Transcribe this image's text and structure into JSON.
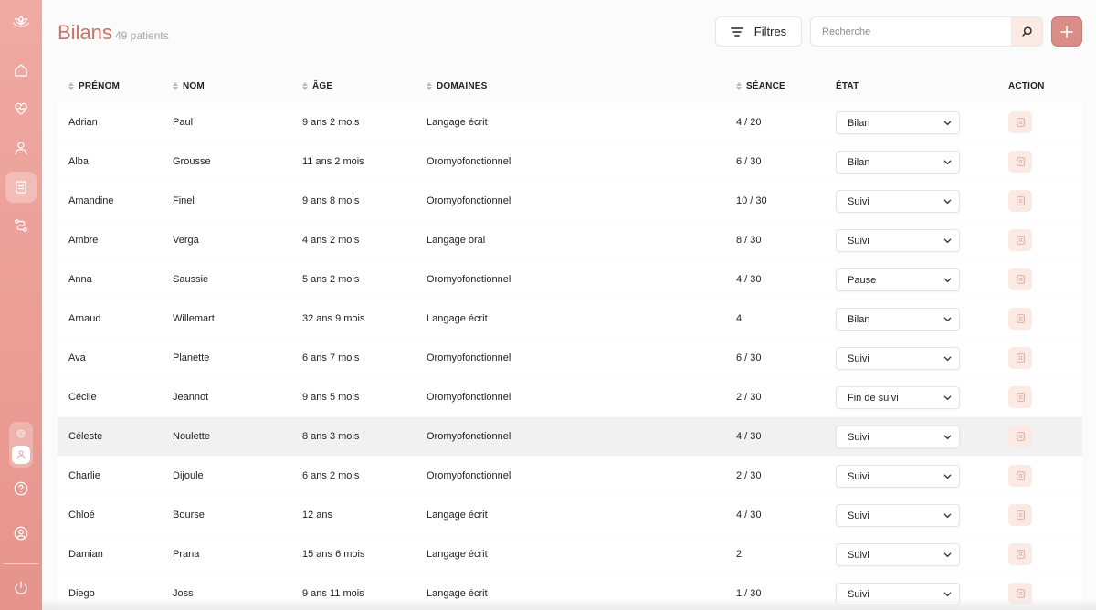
{
  "header": {
    "title": "Bilans",
    "subtitle": "49 patients",
    "filters_label": "Filtres",
    "search_placeholder": "Recherche"
  },
  "columns": [
    "PRÉNOM",
    "NOM",
    "ÂGE",
    "DOMAINES",
    "SÉANCE",
    "ÉTAT",
    "ACTION"
  ],
  "rows": [
    {
      "prenom": "Adrian",
      "nom": "Paul",
      "age": "9 ans 2 mois",
      "domaine": "Langage écrit",
      "seance": "4 / 20",
      "etat": "Bilan"
    },
    {
      "prenom": "Alba",
      "nom": "Grousse",
      "age": "11 ans 2 mois",
      "domaine": "Oromyofonctionnel",
      "seance": "6 / 30",
      "etat": "Bilan"
    },
    {
      "prenom": "Amandine",
      "nom": "Finel",
      "age": "9 ans 8 mois",
      "domaine": "Oromyofonctionnel",
      "seance": "10 / 30",
      "etat": "Suivi"
    },
    {
      "prenom": "Ambre",
      "nom": "Verga",
      "age": "4 ans 2 mois",
      "domaine": "Langage oral",
      "seance": "8 / 30",
      "etat": "Suivi"
    },
    {
      "prenom": "Anna",
      "nom": "Saussie",
      "age": "5 ans 2 mois",
      "domaine": "Oromyofonctionnel",
      "seance": "4 / 30",
      "etat": "Pause"
    },
    {
      "prenom": "Arnaud",
      "nom": "Willemart",
      "age": "32 ans 9 mois",
      "domaine": "Langage écrit",
      "seance": "4",
      "etat": "Bilan"
    },
    {
      "prenom": "Ava",
      "nom": "Planette",
      "age": "6 ans 7 mois",
      "domaine": "Oromyofonctionnel",
      "seance": "6 / 30",
      "etat": "Suivi"
    },
    {
      "prenom": "Cécile",
      "nom": "Jeannot",
      "age": "9 ans 5 mois",
      "domaine": "Oromyofonctionnel",
      "seance": "2 / 30",
      "etat": "Fin de suivi"
    },
    {
      "prenom": "Céleste",
      "nom": "Noulette",
      "age": "8 ans 3 mois",
      "domaine": "Oromyofonctionnel",
      "seance": "4 / 30",
      "etat": "Suivi"
    },
    {
      "prenom": "Charlie",
      "nom": "Dijoule",
      "age": "6 ans 2 mois",
      "domaine": "Oromyofonctionnel",
      "seance": "2 / 30",
      "etat": "Suivi"
    },
    {
      "prenom": "Chloé",
      "nom": "Bourse",
      "age": "12 ans",
      "domaine": "Langage écrit",
      "seance": "4 / 30",
      "etat": "Suivi"
    },
    {
      "prenom": "Damian",
      "nom": "Prana",
      "age": "15 ans 6 mois",
      "domaine": "Langage écrit",
      "seance": "2",
      "etat": "Suivi"
    },
    {
      "prenom": "Diego",
      "nom": "Joss",
      "age": "9 ans 11 mois",
      "domaine": "Langage écrit",
      "seance": "1 / 30",
      "etat": "Suivi"
    }
  ],
  "colors": {
    "accent": "#c9736b",
    "sidebar": "#eea39b",
    "action_bg": "#fbeae4"
  },
  "icons": {
    "sidebar": [
      "lotus-icon",
      "home-icon",
      "heart-pulse-icon",
      "user-icon",
      "document-icon",
      "workflow-icon",
      "settings-icon",
      "user-icon",
      "help-icon",
      "account-icon",
      "power-icon"
    ],
    "toolbar": [
      "filter-icon",
      "search-icon",
      "plus-icon"
    ],
    "row_action": "document-icon"
  }
}
